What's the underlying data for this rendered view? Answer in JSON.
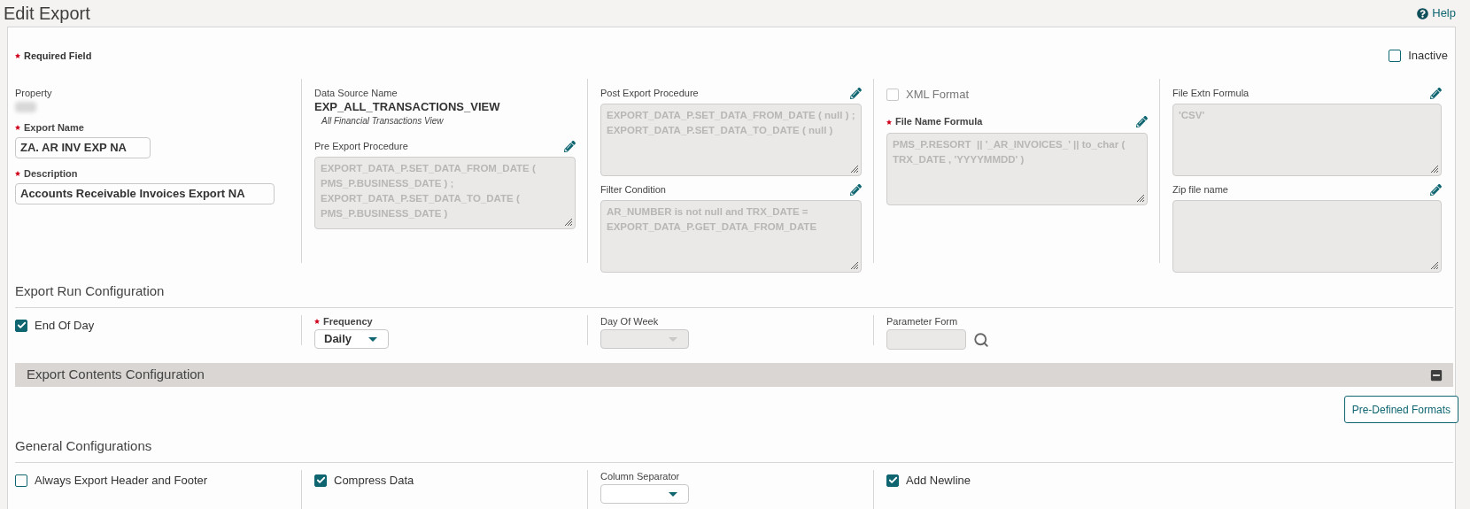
{
  "page": {
    "title": "Edit Export",
    "help": "Help"
  },
  "required_note": "Required Field",
  "inactive": {
    "label": "Inactive",
    "checked": false
  },
  "columns": [
    [
      {
        "kind": "redacted",
        "label": "Property"
      },
      {
        "kind": "input",
        "label": "Export Name",
        "required": true,
        "value": "ZA. AR INV EXP NA"
      },
      {
        "kind": "input",
        "label": "Description",
        "required": true,
        "value": "Accounts Receivable Invoices Export NA"
      }
    ],
    [
      {
        "kind": "display",
        "label": "Data Source Name",
        "value": "EXP_ALL_TRANSACTIONS_VIEW",
        "note": "All Financial Transactions View"
      },
      {
        "kind": "textarea",
        "label": "Pre Export Procedure",
        "required": false,
        "value": "EXPORT_DATA_P.SET_DATA_FROM_DATE ( PMS_P.BUSINESS_DATE ) ; EXPORT_DATA_P.SET_DATA_TO_DATE ( PMS_P.BUSINESS_DATE )"
      }
    ],
    [
      {
        "kind": "textarea",
        "label": "Post Export Procedure",
        "required": false,
        "value": "EXPORT_DATA_P.SET_DATA_FROM_DATE ( null ) ;\nEXPORT_DATA_P.SET_DATA_TO_DATE ( null )"
      },
      {
        "kind": "textarea",
        "label": "Filter Condition",
        "required": false,
        "value": "AR_NUMBER is not null and TRX_DATE =\nEXPORT_DATA_P.GET_DATA_FROM_DATE"
      }
    ],
    [
      {
        "kind": "checkbox",
        "label": "XML Format",
        "checked": false,
        "disabled": true
      },
      {
        "kind": "textarea",
        "label": "File Name Formula",
        "required": true,
        "value": "PMS_P.RESORT  || '_AR_INVOICES_' || to_char (\nTRX_DATE , 'YYYYMMDD' )"
      }
    ],
    [
      {
        "kind": "textarea",
        "label": "File Extn Formula",
        "required": false,
        "value": "'CSV'"
      },
      {
        "kind": "textarea",
        "label": "Zip file name",
        "required": false
      }
    ]
  ],
  "run_config": {
    "title": "Export Run Configuration",
    "fields": [
      {
        "kind": "checkbox",
        "label": "End Of Day",
        "checked": true,
        "disabled": false
      },
      {
        "kind": "select",
        "label": "Frequency",
        "required": true,
        "value": "Daily",
        "disabled": false
      },
      {
        "kind": "select",
        "label": "Day Of Week",
        "required": false,
        "disabled": true
      },
      {
        "kind": "lookup",
        "label": "Parameter Form"
      }
    ]
  },
  "contents_config": {
    "title": "Export Contents Configuration",
    "expanded": true,
    "button": "Pre-Defined Formats"
  },
  "general_config": {
    "title": "General Configurations",
    "fields": [
      {
        "kind": "checkbox",
        "label": "Always Export Header and Footer",
        "checked": false,
        "disabled": false
      },
      {
        "kind": "checkbox",
        "label": "Compress Data",
        "checked": true,
        "disabled": false
      },
      {
        "kind": "select",
        "label": "Column Separator",
        "required": false,
        "disabled": false
      },
      {
        "kind": "checkbox",
        "label": "Add Newline",
        "checked": true,
        "disabled": false
      }
    ]
  }
}
